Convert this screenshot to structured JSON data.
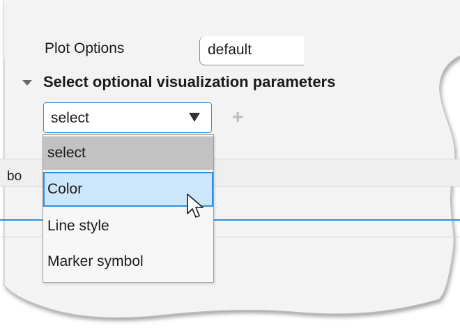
{
  "plot_options": {
    "label": "Plot Options",
    "value": "default"
  },
  "section": {
    "title": "Select optional visualization parameters"
  },
  "select": {
    "value": "select",
    "options": [
      "select",
      "Color",
      "Line style",
      "Marker symbol"
    ],
    "highlighted": "Color"
  },
  "tab": {
    "partial_label": "bo"
  },
  "icons": {
    "expand": "caret-down-icon",
    "dropdown": "dropdown-arrow-icon",
    "add": "plus-icon",
    "cursor": "mouse-pointer-icon"
  },
  "colors": {
    "accent": "#2f8fdc",
    "highlight": "#cce6fb",
    "selected": "#c2c2c2"
  }
}
